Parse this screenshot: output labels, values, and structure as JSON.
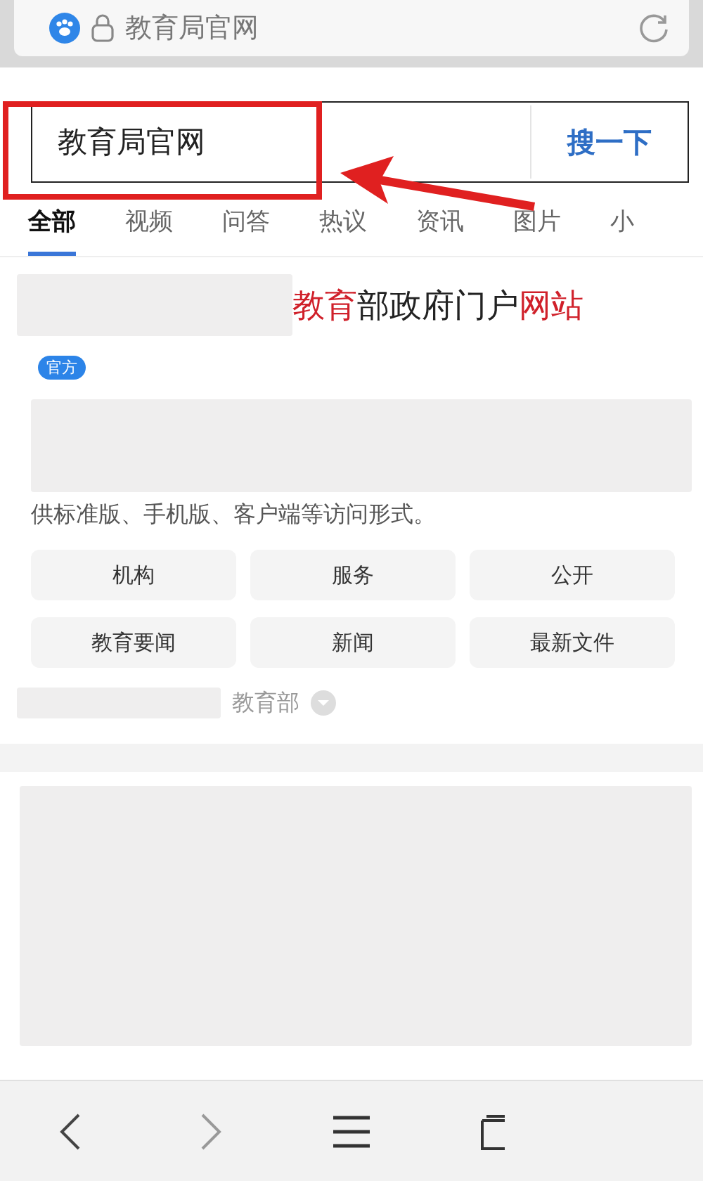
{
  "address_bar": {
    "url_text": "教育局官网"
  },
  "search": {
    "value": "教育局官网",
    "button": "搜一下"
  },
  "annotation": {
    "kind": "box-arrow",
    "color": "#e02020"
  },
  "tabs": [
    {
      "label": "全部",
      "selected": true
    },
    {
      "label": "视频",
      "selected": false
    },
    {
      "label": "问答",
      "selected": false
    },
    {
      "label": "热议",
      "selected": false
    },
    {
      "label": "资讯",
      "selected": false
    },
    {
      "label": "图片",
      "selected": false
    },
    {
      "label": "小",
      "selected": false
    }
  ],
  "result": {
    "title": [
      {
        "text": "教育",
        "highlight": true
      },
      {
        "text": "部政府门户",
        "highlight": false
      },
      {
        "text": "网站",
        "highlight": true
      }
    ],
    "badge": "官方",
    "description": "供标准版、手机版、客户端等访问形式。",
    "links": [
      "机构",
      "服务",
      "公开",
      "教育要闻",
      "新闻",
      "最新文件"
    ],
    "source": "教育部"
  },
  "toolbar": [
    {
      "kind": "back"
    },
    {
      "kind": "forward"
    },
    {
      "kind": "menu"
    },
    {
      "kind": "tabs"
    }
  ]
}
